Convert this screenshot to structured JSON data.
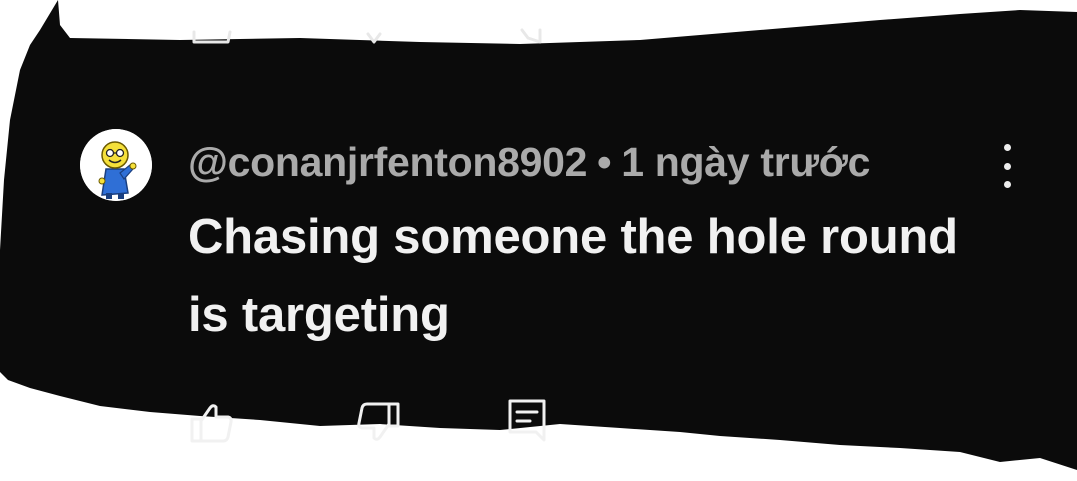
{
  "comment": {
    "author": "@conanjrfenton8902",
    "separator": "•",
    "timestamp": "1 ngày trước",
    "text": "Chasing someone the hole round is targeting",
    "avatar_icon": "cartoon-avatar"
  },
  "icons": {
    "menu": "more-vert-icon",
    "like": "thumbs-up-icon",
    "dislike": "thumbs-down-icon",
    "reply": "reply-comment-icon"
  },
  "colors": {
    "background": "#0b0b0b",
    "text_primary": "#f1f1f1",
    "text_secondary": "#aaaaaa",
    "page_edge": "#ffffff"
  }
}
